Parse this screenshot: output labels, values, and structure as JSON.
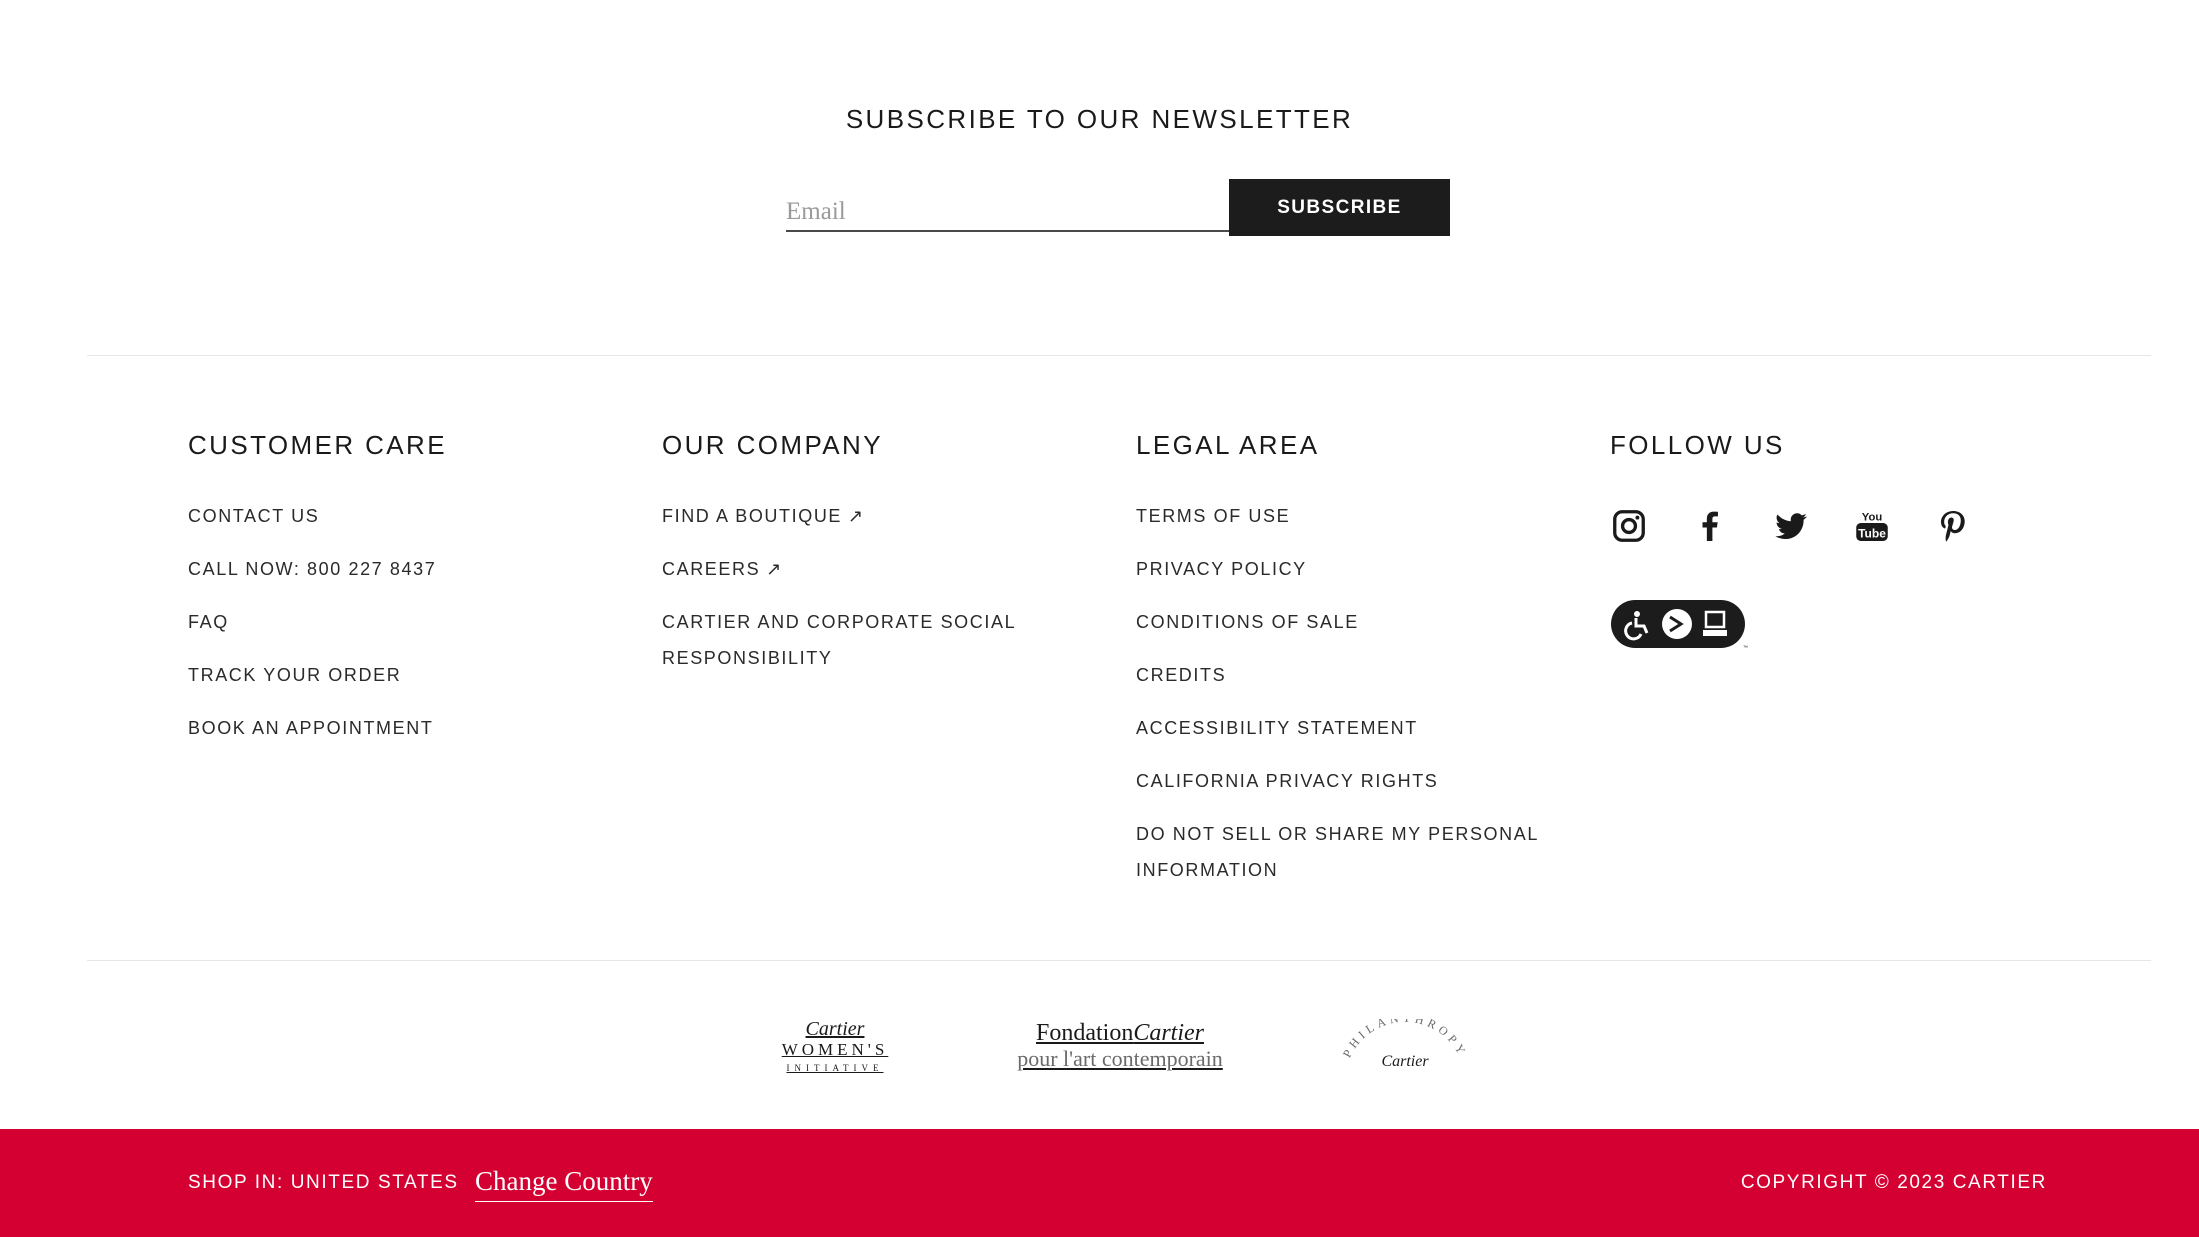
{
  "newsletter": {
    "title": "SUBSCRIBE TO OUR NEWSLETTER",
    "email_placeholder": "Email",
    "subscribe_label": "SUBSCRIBE"
  },
  "columns": {
    "customer_care": {
      "title": "CUSTOMER CARE",
      "links": [
        "CONTACT US",
        "CALL NOW: 800 227 8437",
        "FAQ",
        "TRACK YOUR ORDER",
        "BOOK AN APPOINTMENT"
      ]
    },
    "our_company": {
      "title": "OUR COMPANY",
      "links": [
        "FIND A BOUTIQUE",
        "CAREERS",
        "CARTIER AND CORPORATE SOCIAL RESPONSIBILITY"
      ],
      "external_icon": "↗"
    },
    "legal_area": {
      "title": "LEGAL AREA",
      "links": [
        "TERMS OF USE",
        "PRIVACY POLICY",
        "CONDITIONS OF SALE",
        "CREDITS",
        "ACCESSIBILITY STATEMENT",
        "CALIFORNIA PRIVACY RIGHTS",
        "DO NOT SELL OR SHARE MY PERSONAL INFORMATION"
      ]
    },
    "follow_us": {
      "title": "FOLLOW US",
      "icons": [
        "instagram-icon",
        "facebook-icon",
        "twitter-icon",
        "youtube-icon",
        "pinterest-icon"
      ],
      "youtube_text_top": "You",
      "youtube_text_bottom": "Tube",
      "accessibility_icon": "accessibility-badge-icon"
    }
  },
  "partner_logos": {
    "womens_initiative": {
      "line1": "Cartier",
      "line2": "WOMEN'S",
      "line3": "INITIATIVE"
    },
    "fondation": {
      "line1a": "Fondation",
      "line1b": "Cartier",
      "line2": "pour l'art contemporain"
    },
    "philanthropy": {
      "arc": "PHILANTHROPY",
      "brand": "Cartier"
    }
  },
  "bottom_bar": {
    "shop_in": "SHOP IN: UNITED STATES",
    "change_country": "Change Country",
    "copyright": "COPYRIGHT © 2023 CARTIER",
    "background_color": "#d50032"
  }
}
